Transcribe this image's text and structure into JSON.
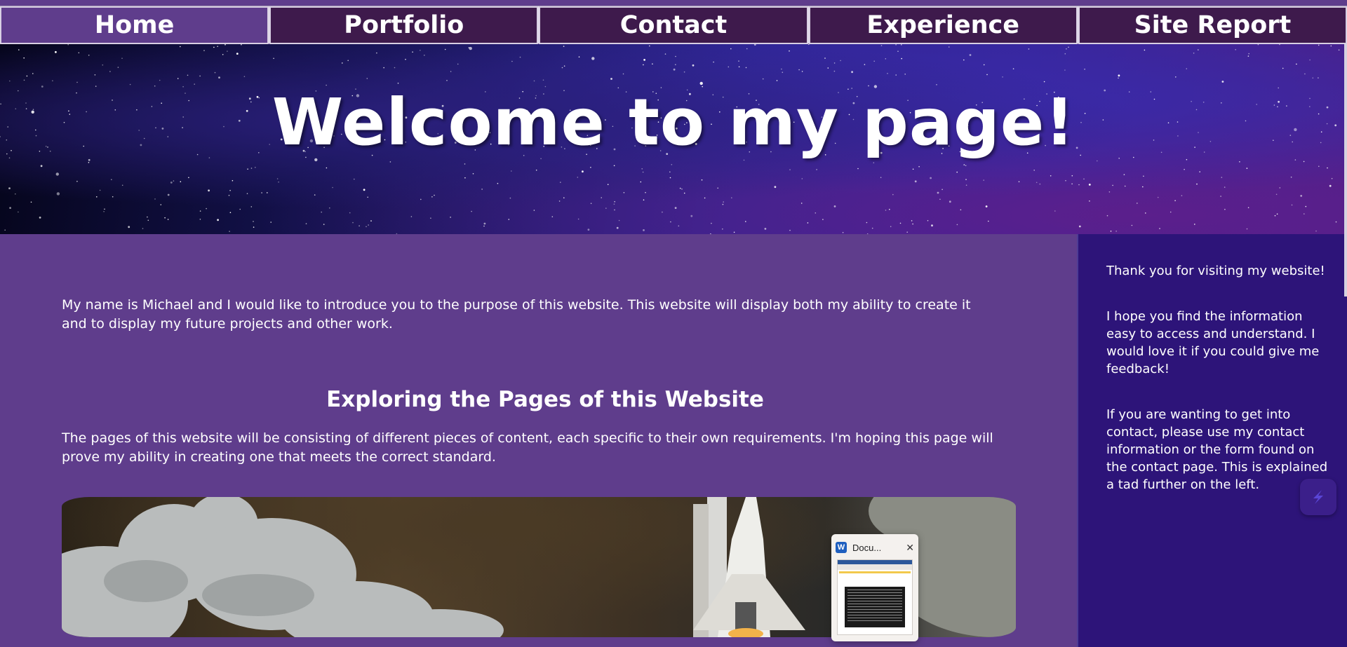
{
  "nav": {
    "items": [
      {
        "label": "Home",
        "active": true
      },
      {
        "label": "Portfolio",
        "active": false
      },
      {
        "label": "Contact",
        "active": false
      },
      {
        "label": "Experience",
        "active": false
      },
      {
        "label": "Site Report",
        "active": false
      }
    ]
  },
  "hero": {
    "title": "Welcome to my page!"
  },
  "main": {
    "intro": "My name is Michael and I would like to introduce you to the purpose of this website. This website will display both my ability to create it and to display my future projects and other work.",
    "section_heading": "Exploring the Pages of this Website",
    "section_text": "The pages of this website will be consisting of different pieces of content, each specific to their own requirements. I'm hoping this page will prove my ability in creating one that meets the correct standard."
  },
  "sidebar": {
    "p1": "Thank you for visiting my website!",
    "p2": "I hope you find the information easy to access and understand. I would love it if you could give me feedback!",
    "p3": "If you are wanting to get into contact, please use my contact information or the form found on the contact page. This is explained a tad further on the left."
  },
  "taskbar_thumbnail": {
    "title": "Docu...",
    "app_icon": "word-icon"
  },
  "colors": {
    "page_bg": "#5f3d8c",
    "nav_bg": "#3e1a4c",
    "nav_active": "#5f3d8c",
    "sidebar_bg": "#2d1479"
  }
}
